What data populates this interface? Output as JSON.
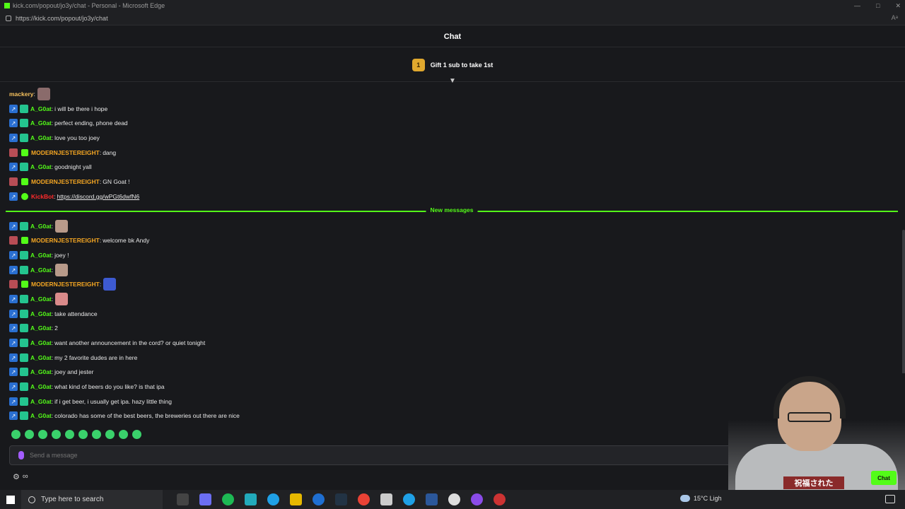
{
  "window": {
    "title": "kick.com/popout/jo3y/chat - Personal - Microsoft Edge",
    "url": "https://kick.com/popout/jo3y/chat",
    "reader_label": "Aᵃ"
  },
  "chat": {
    "header_title": "Chat",
    "gift": {
      "rank": "1",
      "label": "Gift 1 sub to take 1st"
    },
    "new_messages_label": "New messages",
    "input_placeholder": "Send a message",
    "send_label": "Chat",
    "tools_label": "∞"
  },
  "messages": [
    {
      "user": "mackery",
      "user_color": "yellow",
      "text": "",
      "emote": "cat-emote"
    },
    {
      "user": "A_G0at",
      "user_color": "green",
      "text": "i will be there i hope"
    },
    {
      "user": "A_G0at",
      "user_color": "green",
      "text": "perfect ending, phone dead"
    },
    {
      "user": "A_G0at",
      "user_color": "green",
      "text": "love you too joey"
    },
    {
      "user": "MODERNJESTEREIGHT",
      "user_color": "orange",
      "text": "dang"
    },
    {
      "user": "A_G0at",
      "user_color": "green",
      "text": "goodnight yall"
    },
    {
      "user": "MODERNJESTEREIGHT",
      "user_color": "orange",
      "text": "GN Goat !"
    },
    {
      "user": "KickBot",
      "user_color": "red",
      "text": "https://discord.gg/wPGt6dwfN6"
    },
    {
      "user": "A_G0at",
      "user_color": "green",
      "text": "",
      "emote": "face-emote"
    },
    {
      "user": "MODERNJESTEREIGHT",
      "user_color": "orange",
      "text": "welcome bk Andy"
    },
    {
      "user": "A_G0at",
      "user_color": "green",
      "text": "joey !"
    },
    {
      "user": "A_G0at",
      "user_color": "green",
      "text": "",
      "emote": "face-emote"
    },
    {
      "user": "MODERNJESTEREIGHT",
      "user_color": "orange",
      "text": "",
      "emote": "astronaut-emote"
    },
    {
      "user": "A_G0at",
      "user_color": "green",
      "text": "",
      "emote": "pink-emote"
    },
    {
      "user": "A_G0at",
      "user_color": "green",
      "text": "take attendance"
    },
    {
      "user": "A_G0at",
      "user_color": "green",
      "text": "2"
    },
    {
      "user": "A_G0at",
      "user_color": "green",
      "text": "want another announcement in the cord? or quiet tonight"
    },
    {
      "user": "A_G0at",
      "user_color": "green",
      "text": "my 2 favorite dudes are in here"
    },
    {
      "user": "A_G0at",
      "user_color": "green",
      "text": "joey and jester"
    },
    {
      "user": "A_G0at",
      "user_color": "green",
      "text": "what kind of beers do you like? is that ipa"
    },
    {
      "user": "A_G0at",
      "user_color": "green",
      "text": "if i get beer, i usually get ipa. hazy little thing"
    },
    {
      "user": "A_G0at",
      "user_color": "green",
      "text": "colorado has some of the best beers, the breweries out there are nice"
    }
  ],
  "webcam": {
    "shirt_text": "祝福された"
  },
  "taskbar": {
    "search_placeholder": "Type here to search",
    "weather": "15°C  Ligh"
  },
  "colors": {
    "accent": "#53fc18",
    "background": "#18191c"
  }
}
